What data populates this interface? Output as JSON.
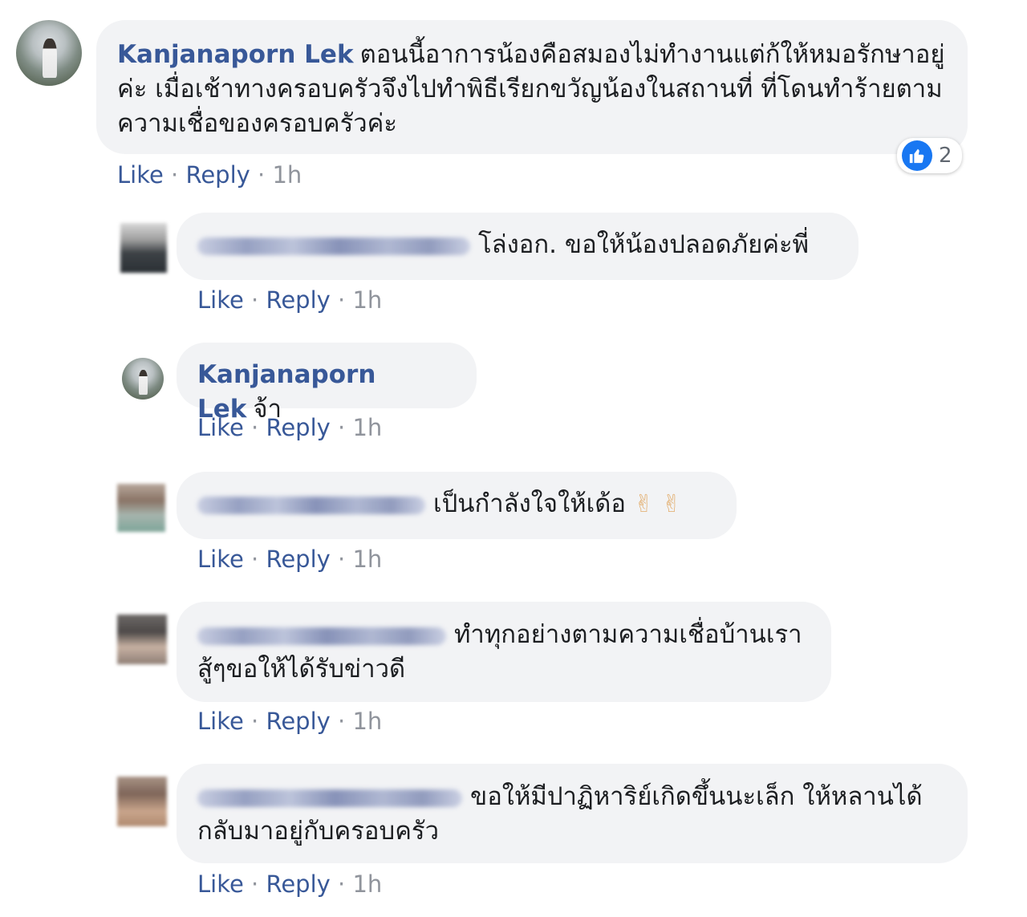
{
  "comments": [
    {
      "author": "Kanjanaporn Lek",
      "text": "ตอนนี้อาการน้องคือสมองไม่ทำงานแต่ก้ให้หมอรักษาอยู่ค่ะ เมื่อเช้าทางครอบครัวจึงไปทำพิธีเรียกขวัญน้องในสถานที่ ที่โดนทำร้ายตามความเชื่อของครอบครัวค่ะ",
      "like": "Like",
      "reply": "Reply",
      "time": "1h",
      "reaction_count": "2",
      "reaction_icon": "thumbs-up-icon"
    }
  ],
  "replies": [
    {
      "author": "",
      "text": "โล่งอก. ขอให้น้องปลอดภัยค่ะพี่",
      "like": "Like",
      "reply": "Reply",
      "time": "1h"
    },
    {
      "author": "Kanjanaporn Lek",
      "text": "จ้า",
      "like": "Like",
      "reply": "Reply",
      "time": "1h"
    },
    {
      "author": "",
      "text": "เป็นกำลังใจให้เด้อ",
      "emoji": "✌ ✌",
      "like": "Like",
      "reply": "Reply",
      "time": "1h"
    },
    {
      "author": "",
      "text": "ทำทุกอย่างตามความเชื่อบ้านเรา สู้ๆขอให้ได้รับข่าวดี",
      "like": "Like",
      "reply": "Reply",
      "time": "1h"
    },
    {
      "author": "",
      "text": "ขอให้มีปาฏิหาริย์เกิดขึ้นนะเล็ก ให้หลานได้กลับมาอยู่กับครอบครัว",
      "like": "Like",
      "reply": "Reply",
      "time": "1h"
    }
  ],
  "separator": "·",
  "colors": {
    "link": "#385898",
    "bubble": "#f2f3f5",
    "meta": "#90949c",
    "like_badge": "#1877f2"
  }
}
